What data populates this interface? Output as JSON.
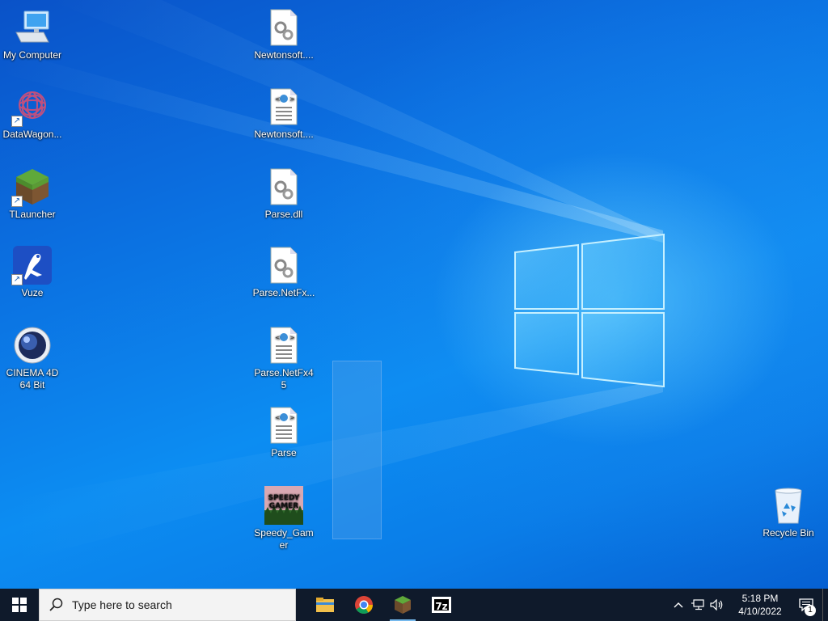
{
  "desktop": {
    "left_icons": [
      {
        "label": "My Computer",
        "icon": "computer-icon"
      },
      {
        "label": "DataWagon...",
        "icon": "datawagon-icon"
      },
      {
        "label": "TLauncher",
        "icon": "minecraft-grass-icon"
      },
      {
        "label": "Vuze",
        "icon": "vuze-frog-icon"
      },
      {
        "label": "CINEMA 4D 64 Bit",
        "icon": "cinema4d-icon"
      }
    ],
    "middle_icons": [
      {
        "label": "Newtonsoft....",
        "icon": "dll-file-icon"
      },
      {
        "label": "Newtonsoft....",
        "icon": "xml-file-icon"
      },
      {
        "label": "Parse.dll",
        "icon": "dll-file-icon"
      },
      {
        "label": "Parse.NetFx...",
        "icon": "dll-file-icon"
      },
      {
        "label": "Parse.NetFx45",
        "icon": "xml-file-icon"
      },
      {
        "label": "Parse",
        "icon": "xml-file-icon"
      },
      {
        "label": "Speedy_Gamer",
        "icon": "speedy-gamer-image-icon",
        "thumb_text": "SPEEDY GAMER"
      }
    ],
    "recycle_bin": {
      "label": "Recycle Bin",
      "icon": "recycle-bin-icon"
    }
  },
  "taskbar": {
    "search_placeholder": "Type here to search",
    "pinned": [
      {
        "name": "file-explorer",
        "icon": "folder-icon"
      },
      {
        "name": "chrome",
        "icon": "chrome-icon"
      },
      {
        "name": "tlauncher",
        "icon": "minecraft-grass-icon",
        "active": true
      },
      {
        "name": "7zip",
        "icon": "7zip-icon",
        "text": "7z"
      }
    ],
    "clock": {
      "time": "5:18 PM",
      "date": "4/10/2022"
    },
    "notification_count": "1"
  },
  "colors": {
    "taskbar": "#0f1a2b",
    "desktop_blue": "#0b6fe0",
    "accent": "#76b9ed"
  }
}
